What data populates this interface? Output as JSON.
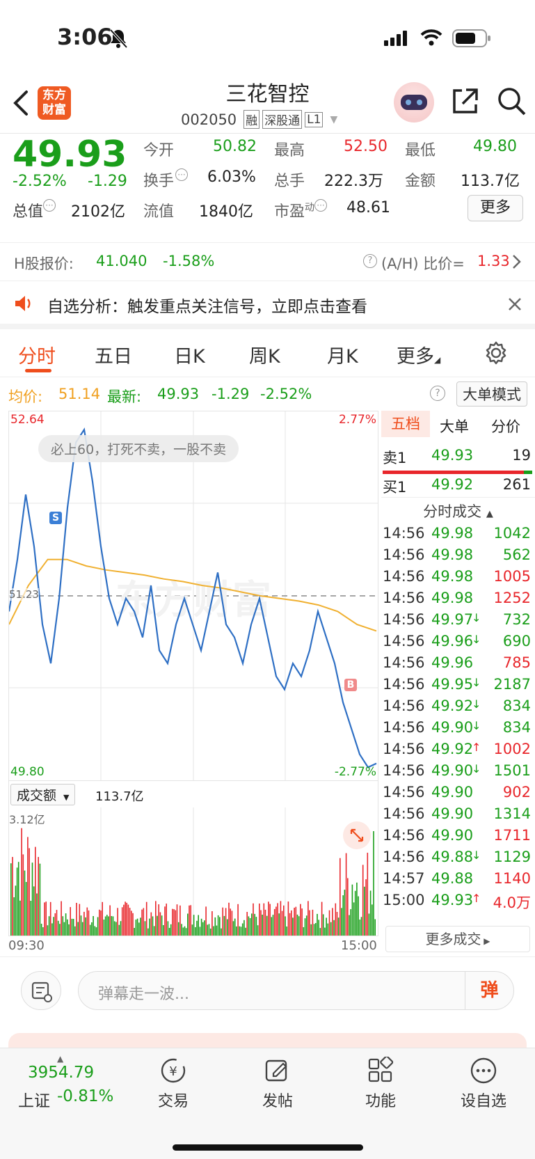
{
  "status": {
    "time": "3:06"
  },
  "header": {
    "logo": "东方\n财富",
    "logo_line1": "东方",
    "logo_line2": "财富",
    "title": "三花智控",
    "code": "002050",
    "tags": [
      "融",
      "深股通",
      "L1"
    ]
  },
  "quote": {
    "price": "49.93",
    "pct": "-2.52%",
    "chg": "-1.29",
    "fields": [
      {
        "label": "今开",
        "value": "50.82"
      },
      {
        "label": "最高",
        "value": "52.50"
      },
      {
        "label": "最低",
        "value": "49.80"
      },
      {
        "label": "换手",
        "value": "6.03%"
      },
      {
        "label": "总手",
        "value": "222.3万"
      },
      {
        "label": "金额",
        "value": "113.7亿"
      },
      {
        "label": "总值",
        "value": "2102亿"
      },
      {
        "label": "流值",
        "value": "1840亿"
      },
      {
        "label": "市盈",
        "sup": "动",
        "value": "48.61"
      }
    ],
    "more": "更多"
  },
  "hshare": {
    "label": "H股报价:",
    "price": "41.040",
    "pct": "-1.58%",
    "ratio_label": "(A/H) 比价=",
    "ratio": "1.33"
  },
  "banner": {
    "text": "自选分析：触发重点关注信号，立即点击查看"
  },
  "tabs": [
    "分时",
    "五日",
    "日K",
    "周K",
    "月K",
    "更多"
  ],
  "info": {
    "avg_label": "均价:",
    "avg": "51.14",
    "latest_label": "最新:",
    "latest": "49.93",
    "chg": "-1.29",
    "pct": "-2.52%",
    "mode": "大单模式"
  },
  "chart": {
    "high": "52.64",
    "low": "49.80",
    "pct_high": "2.77%",
    "pct_low": "-2.77%",
    "mid": "51.23",
    "watermark": "东方财富",
    "danmu": "必上60，打死不卖，一股不卖",
    "vol_label": "成交额",
    "vol_total": "113.7亿",
    "vol_max": "3.12亿",
    "t_start": "09:30",
    "t_end": "15:00"
  },
  "chart_data": {
    "type": "line",
    "x_range": [
      "09:30",
      "15:00"
    ],
    "ylim": [
      49.8,
      52.64
    ],
    "series": [
      {
        "name": "price",
        "values": [
          51.1,
          51.5,
          52.0,
          51.6,
          51.0,
          50.7,
          51.2,
          51.9,
          52.4,
          52.5,
          52.1,
          51.6,
          51.2,
          51.0,
          51.2,
          51.1,
          50.9,
          51.3,
          50.8,
          50.7,
          51.0,
          51.2,
          51.0,
          50.8,
          51.1,
          51.4,
          51.0,
          50.9,
          50.7,
          51.0,
          51.2,
          50.9,
          50.6,
          50.5,
          50.7,
          50.6,
          50.8,
          51.1,
          50.9,
          50.7,
          50.4,
          50.2,
          50.0,
          49.9,
          49.93
        ]
      },
      {
        "name": "均价",
        "values": [
          51.0,
          51.3,
          51.5,
          51.5,
          51.45,
          51.42,
          51.4,
          51.38,
          51.35,
          51.33,
          51.3,
          51.28,
          51.25,
          51.22,
          51.2,
          51.18,
          51.15,
          51.1,
          51.0,
          50.95
        ]
      }
    ]
  },
  "book": {
    "tabs": [
      "五档",
      "大单",
      "分价"
    ],
    "sell": {
      "label": "卖1",
      "price": "49.93",
      "vol": "19"
    },
    "buy": {
      "label": "买1",
      "price": "49.92",
      "vol": "261"
    },
    "ticks_header": "分时成交",
    "ticks": [
      {
        "t": "14:56",
        "p": "49.98",
        "a": "",
        "v": "1042",
        "c": "green"
      },
      {
        "t": "14:56",
        "p": "49.98",
        "a": "",
        "v": "562",
        "c": "green"
      },
      {
        "t": "14:56",
        "p": "49.98",
        "a": "",
        "v": "1005",
        "c": "red"
      },
      {
        "t": "14:56",
        "p": "49.98",
        "a": "",
        "v": "1252",
        "c": "red"
      },
      {
        "t": "14:56",
        "p": "49.97",
        "a": "↓",
        "v": "732",
        "c": "green"
      },
      {
        "t": "14:56",
        "p": "49.96",
        "a": "↓",
        "v": "690",
        "c": "green"
      },
      {
        "t": "14:56",
        "p": "49.96",
        "a": "",
        "v": "785",
        "c": "red"
      },
      {
        "t": "14:56",
        "p": "49.95",
        "a": "↓",
        "v": "2187",
        "c": "green"
      },
      {
        "t": "14:56",
        "p": "49.92",
        "a": "↓",
        "v": "834",
        "c": "green"
      },
      {
        "t": "14:56",
        "p": "49.90",
        "a": "↓",
        "v": "834",
        "c": "green"
      },
      {
        "t": "14:56",
        "p": "49.92",
        "a": "↑",
        "v": "1002",
        "c": "red"
      },
      {
        "t": "14:56",
        "p": "49.90",
        "a": "↓",
        "v": "1501",
        "c": "green"
      },
      {
        "t": "14:56",
        "p": "49.90",
        "a": "",
        "v": "902",
        "c": "red"
      },
      {
        "t": "14:56",
        "p": "49.90",
        "a": "",
        "v": "1314",
        "c": "green"
      },
      {
        "t": "14:56",
        "p": "49.90",
        "a": "",
        "v": "1711",
        "c": "red"
      },
      {
        "t": "14:56",
        "p": "49.88",
        "a": "↓",
        "v": "1129",
        "c": "green"
      },
      {
        "t": "14:57",
        "p": "49.88",
        "a": "",
        "v": "1140",
        "c": "red"
      },
      {
        "t": "15:00",
        "p": "49.93",
        "a": "↑",
        "v": "4.0万",
        "c": "red"
      }
    ],
    "more": "更多成交"
  },
  "comment": {
    "placeholder": "弹幕走一波...",
    "btn": "弹"
  },
  "bottom": {
    "index_value": "3954.79",
    "index_name": "上证",
    "index_pct": "-0.81%",
    "nav": [
      "交易",
      "发帖",
      "功能",
      "设自选"
    ]
  }
}
